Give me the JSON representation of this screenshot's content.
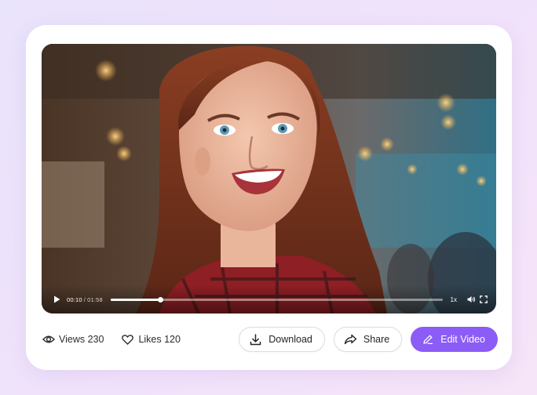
{
  "player": {
    "current_time": "00:10",
    "separator": "/",
    "duration": "01:58",
    "progress_fraction": 0.15,
    "speed": "1x",
    "icons": {
      "play": "play-icon",
      "volume": "volume-icon",
      "fullscreen": "fullscreen-icon"
    }
  },
  "stats": {
    "views_label": "Views 230",
    "likes_label": "Likes 120",
    "icons": {
      "views": "eye-icon",
      "likes": "heart-icon"
    }
  },
  "actions": {
    "download_label": "Download",
    "share_label": "Share",
    "edit_label": "Edit Video",
    "icons": {
      "download": "download-icon",
      "share": "share-icon",
      "edit": "pencil-icon"
    }
  },
  "colors": {
    "accent": "#8b5cf6",
    "background": "#efe4fb",
    "card": "#ffffff"
  }
}
